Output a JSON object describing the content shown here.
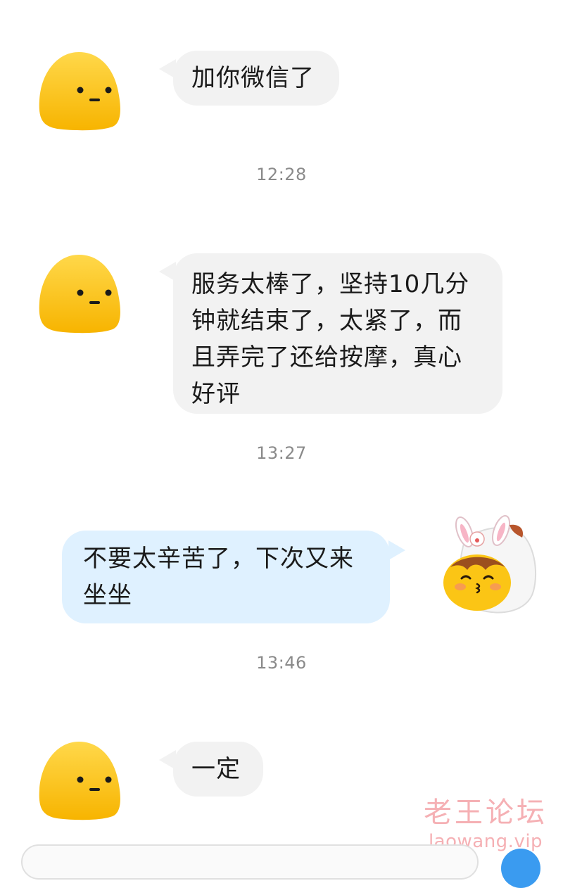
{
  "messages": [
    {
      "side": "incoming",
      "text": "加你微信了"
    },
    {
      "side": "incoming",
      "text": "服务太棒了，坚持10几分钟就结束了，太紧了，而且弄完了还给按摩，真心好评"
    },
    {
      "side": "outgoing",
      "text": "不要太辛苦了，下次又来坐坐"
    },
    {
      "side": "incoming",
      "text": "一定"
    }
  ],
  "timestamps": [
    "12:28",
    "13:27",
    "13:46"
  ],
  "watermark": {
    "cn": "老王论坛",
    "url": "laowang.vip"
  },
  "colors": {
    "incoming_bubble": "#f2f2f2",
    "outgoing_bubble": "#dff1ff",
    "avatar_yellow": "#fbc515",
    "timestamp_text": "#8a8a8a",
    "send_button": "#3a9bf0"
  },
  "icons": {
    "contact_avatar": "yellow-blob-avatar",
    "self_avatar": "bunny-hat-avatar"
  }
}
